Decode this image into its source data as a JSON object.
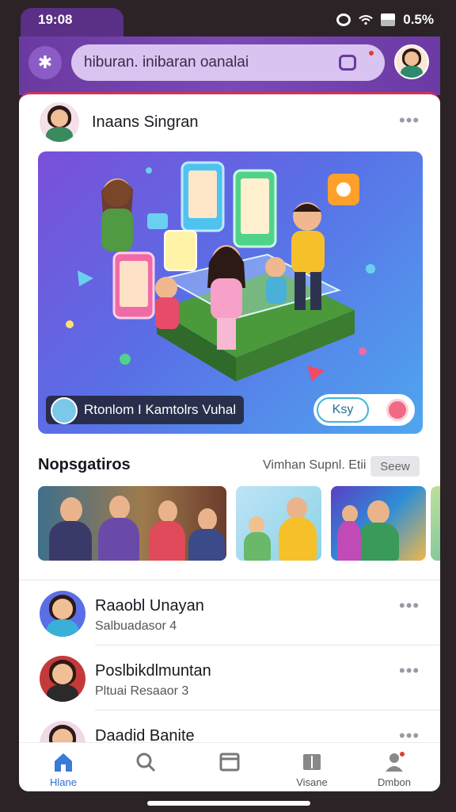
{
  "status_bar": {
    "time": "19:08",
    "battery": "0.5%"
  },
  "header": {
    "search_text": "hiburan. inibaran oanalai"
  },
  "post": {
    "author": "Inaans Singran",
    "hero_caption": "Rtonlom I Kamtolrs Vuhal",
    "hero_button": "Ksy"
  },
  "section": {
    "title": "Nopsgatiros",
    "subtitle": "Vimhan Supnl. Etii",
    "button": "Seew"
  },
  "list": [
    {
      "title": "Raaobl Unayan",
      "subtitle": "Salbuadasor 4"
    },
    {
      "title": "Poslbikdlmuntan",
      "subtitle": "Pltuai Resaaor 3"
    },
    {
      "title": "Daadid Banite",
      "subtitle": ""
    }
  ],
  "bottom_nav": [
    {
      "label": "Hlane",
      "icon": "home-icon",
      "active": true
    },
    {
      "label": "",
      "icon": "search-icon",
      "active": false
    },
    {
      "label": "",
      "icon": "window-icon",
      "active": false
    },
    {
      "label": "Visane",
      "icon": "book-icon",
      "active": false
    },
    {
      "label": "Dmbon",
      "icon": "profile-icon",
      "active": false
    }
  ],
  "colors": {
    "header_purple": "#6a3aa0",
    "accent_blue": "#2f6fd0",
    "top_border": "#c9375a"
  }
}
